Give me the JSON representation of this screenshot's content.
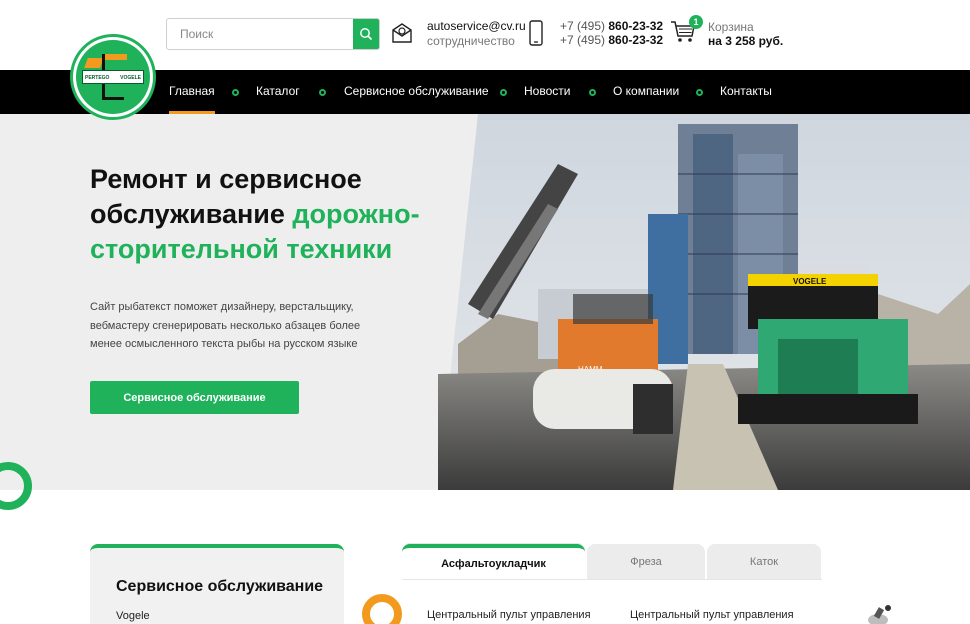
{
  "header": {
    "logo_text_left": "PERTEGO",
    "logo_text_right": "VOGELE",
    "search_placeholder": "Поиск",
    "email": "autoservice@cv.ru",
    "email_sub": "сотрудничество",
    "phones": [
      {
        "prefix": "+7 (495) ",
        "number": "860-23-32"
      },
      {
        "prefix": "+7 (495) ",
        "number": "860-23-32"
      }
    ],
    "cart": {
      "count": "1",
      "label": "Корзина",
      "sum": "на 3 258 руб."
    }
  },
  "nav": {
    "items": [
      "Главная",
      "Каталог",
      "Сервисное обслуживание",
      "Новости",
      "О компании",
      "Контакты"
    ]
  },
  "hero": {
    "title_plain": "Ремонт и сервисное обслуживание ",
    "title_green": "дорожно-сторительной техники",
    "text": "Сайт рыбатекст поможет дизайнеру, верстальщику, вебмастеру сгенерировать несколько абзацев более менее осмысленного текста рыбы на русском языке",
    "button": "Сервисное обслуживание",
    "paver_brand": "VOGELE",
    "roller_brand": "HAMM"
  },
  "service_card": {
    "title": "Сервисное обслуживание",
    "subtitle": "Vogele"
  },
  "tabs": [
    "Асфальтоукладчик",
    "Фреза",
    "Каток"
  ],
  "specs": [
    "Центральный пульт управления",
    "Центральный пульт управления"
  ],
  "colors": {
    "accent": "#1fb25a",
    "orange": "#f29a1e",
    "nav_bg": "#000000"
  }
}
